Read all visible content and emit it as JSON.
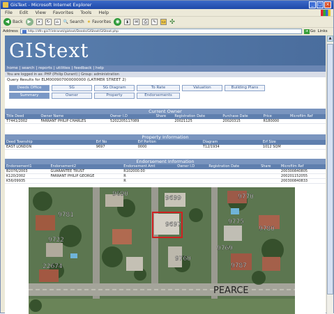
{
  "window": {
    "title": "GisText - Microsoft Internet Explorer"
  },
  "menu": [
    "File",
    "Edit",
    "View",
    "Favorites",
    "Tools",
    "Help"
  ],
  "toolbar": {
    "back": "Back",
    "search": "Search",
    "favorites": "Favorites"
  },
  "address": {
    "label": "Address",
    "url": "http://dfn-gis7/intranet/gistext/Deeds/GIStext/GIStext.php",
    "go": "Go",
    "links": "Links"
  },
  "site": {
    "title": "GIStext",
    "nav": [
      "home",
      "search",
      "reports",
      "utilities",
      "feedback",
      "help"
    ],
    "login_line": "You are logged in as: PHP (Philip Durant) | Group: administration",
    "query": "Query Results for ELM000907000000000 (LATIMER STREET 2)"
  },
  "tabs_row1": [
    "Deeds Office",
    "SG",
    "SG Diagram",
    "To Rate",
    "Valuation",
    "Building Plans"
  ],
  "tabs_row2": [
    "Summary",
    "Owner",
    "Property",
    "Endorsements"
  ],
  "current_owner": {
    "title": "Current Owner",
    "headers": [
      "Title Deed",
      "Owner Name",
      "Owner I.D",
      "Share",
      "Registration Date",
      "Purchase Date",
      "Price",
      "Microfilm Ref"
    ],
    "rows": [
      [
        "T7441/2002",
        "FARRANT PHILIP CHARLES",
        "5202205117089",
        "",
        "20021125",
        "20020315",
        "R180000",
        ""
      ]
    ]
  },
  "property_info": {
    "title": "Property Information",
    "headers": [
      "Deed Township",
      "Erf No",
      "Erf Portion",
      "Diagram",
      "Erf Size"
    ],
    "rows": [
      [
        "EAST LONDON",
        "9697",
        "0000",
        "T12/1934",
        "1012 SQM"
      ]
    ]
  },
  "endorsement_info": {
    "title": "Endorsement Information",
    "headers": [
      "Endorsement1",
      "Endorsement2",
      "Endorsement Amt",
      "Owner I.D",
      "Registration Date",
      "Share",
      "Microfilm Ref"
    ],
    "rows": [
      [
        "B2076/2003",
        "GUARANTEE TRUST",
        "R102000.00",
        "",
        "",
        "",
        "200300840805"
      ],
      [
        "K120/2002",
        "FARRANT PHILIP GEORGE",
        "R",
        "",
        "",
        "",
        "200201152055"
      ],
      [
        "K56/09935",
        "",
        "R",
        "",
        "",
        "",
        "200300840833"
      ]
    ]
  },
  "map": {
    "labels": [
      "9690",
      "9699",
      "9781",
      "9697",
      "9770",
      "9780",
      "9722",
      "9775",
      "22674",
      "9769",
      "9787",
      "9760"
    ],
    "street": "PEARCE"
  }
}
